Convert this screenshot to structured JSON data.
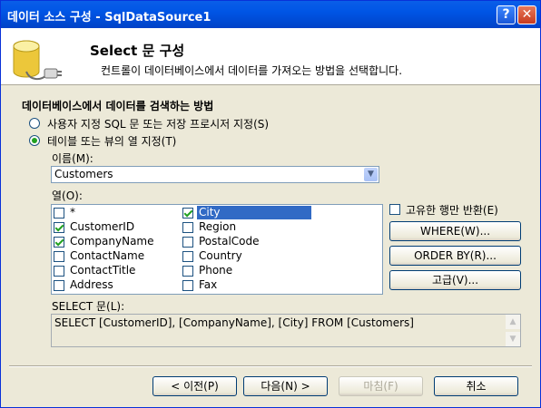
{
  "window": {
    "title": "데이터 소스 구성 - SqlDataSource1",
    "help_label": "?",
    "close_label": "✕"
  },
  "header": {
    "title": "Select 문 구성",
    "subtitle": "컨트롤이 데이터베이스에서 데이터를 가져오는 방법을 선택합니다."
  },
  "section_title": "데이터베이스에서 데이터를 검색하는 방법",
  "options": {
    "sql": "사용자 지정 SQL 문 또는 저장 프로시저 지정(S)",
    "table": "테이블 또는 뷰의 열 지정(T)",
    "selected": "table"
  },
  "name_label": "이름(M):",
  "name_value": "Customers",
  "columns_label": "열(O):",
  "columns": [
    {
      "name": "*",
      "checked": false
    },
    {
      "name": "CustomerID",
      "checked": true
    },
    {
      "name": "CompanyName",
      "checked": true
    },
    {
      "name": "ContactName",
      "checked": false
    },
    {
      "name": "ContactTitle",
      "checked": false
    },
    {
      "name": "Address",
      "checked": false
    },
    {
      "name": "City",
      "checked": true
    },
    {
      "name": "Region",
      "checked": false
    },
    {
      "name": "PostalCode",
      "checked": false
    },
    {
      "name": "Country",
      "checked": false
    },
    {
      "name": "Phone",
      "checked": false
    },
    {
      "name": "Fax",
      "checked": false
    }
  ],
  "distinct_label": "고유한 행만 반환(E)",
  "buttons": {
    "where": "WHERE(W)...",
    "orderby": "ORDER BY(R)...",
    "advanced": "고급(V)..."
  },
  "select_label": "SELECT 문(L):",
  "select_statement": "SELECT [CustomerID], [CompanyName], [City] FROM [Customers]",
  "footer": {
    "prev": "< 이전(P)",
    "next": "다음(N) >",
    "finish": "마침(F)",
    "cancel": "취소"
  }
}
